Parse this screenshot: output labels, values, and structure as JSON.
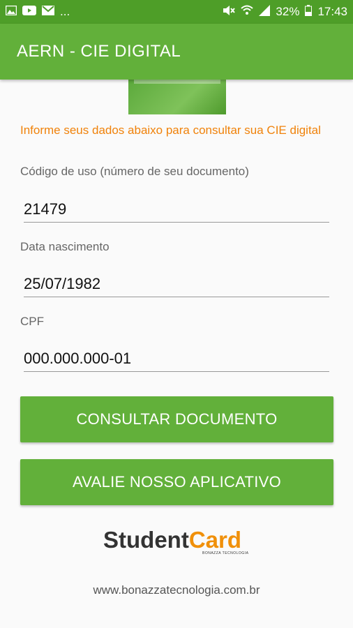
{
  "status_bar": {
    "overflow_indicator": "...",
    "battery_percent": "32%",
    "time": "17:43",
    "icons_left": [
      "image-icon",
      "youtube-icon",
      "mail-icon"
    ],
    "icons_right": [
      "mute-icon",
      "wifi-icon",
      "signal-icon",
      "battery-icon"
    ]
  },
  "app_bar": {
    "title": "AERN - CIE DIGITAL"
  },
  "form": {
    "info_text": "Informe seus dados abaixo para consultar sua CIE digital",
    "codigo_label": "Código de uso (número de seu documento)",
    "codigo_value": "21479",
    "nascimento_label": "Data nascimento",
    "nascimento_value": "25/07/1982",
    "cpf_label": "CPF",
    "cpf_value": "000.000.000-01"
  },
  "buttons": {
    "consultar_label": "CONSULTAR DOCUMENTO",
    "avalie_label": "AVALIE NOSSO APLICATIVO"
  },
  "brand": {
    "student": "Student",
    "card": "Card",
    "sub": "BONAZZA TECNOLOGIA"
  },
  "footer": {
    "url": "www.bonazzatecnologia.com.br"
  },
  "colors": {
    "status_bar": "#4e9e28",
    "primary": "#62b03a",
    "info_text": "#f0820a",
    "brand_card": "#f0900a"
  }
}
